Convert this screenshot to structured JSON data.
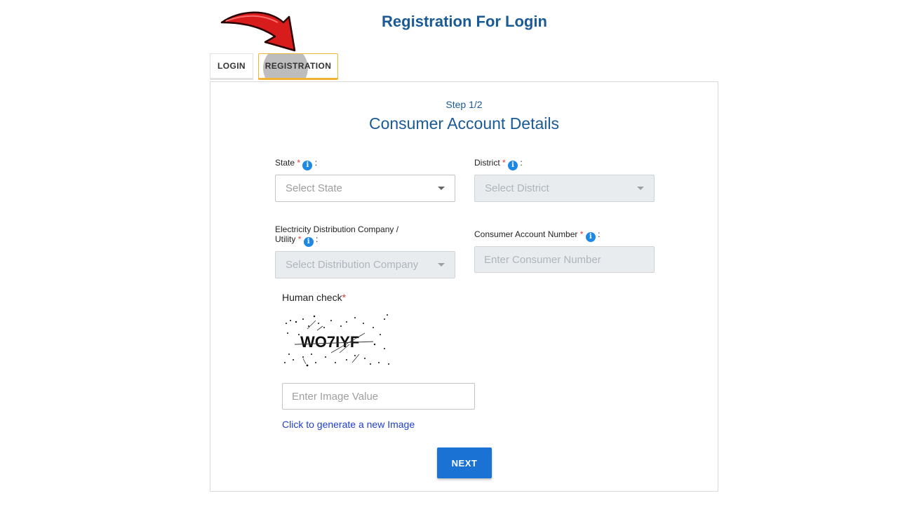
{
  "page": {
    "title": "Registration For Login"
  },
  "tabs": [
    {
      "label": "LOGIN",
      "active": false
    },
    {
      "label": "REGISTRATION",
      "active": true
    }
  ],
  "form": {
    "step": "Step 1/2",
    "title": "Consumer Account Details",
    "state": {
      "label": "State",
      "placeholder": "Select State"
    },
    "district": {
      "label": "District",
      "placeholder": "Select District"
    },
    "utility": {
      "label_line1": "Electricity Distribution Company /",
      "label_line2": "Utility",
      "placeholder": "Select Distribution Company"
    },
    "account": {
      "label": "Consumer Account Number",
      "placeholder": "Enter Consumer Number"
    },
    "required_mark": "*",
    "info_glyph": "i",
    "colon": ":",
    "human_check": {
      "label": "Human check",
      "captcha_text": "WO7IYF",
      "placeholder": "Enter Image Value",
      "refresh_link": "Click to generate a new Image"
    },
    "next_button": "NEXT"
  },
  "colors": {
    "primary": "#1a73d4",
    "title": "#1a5a96",
    "active_tab_border": "#f2b233",
    "required": "#e53935",
    "arrow": "#d81b1b"
  }
}
